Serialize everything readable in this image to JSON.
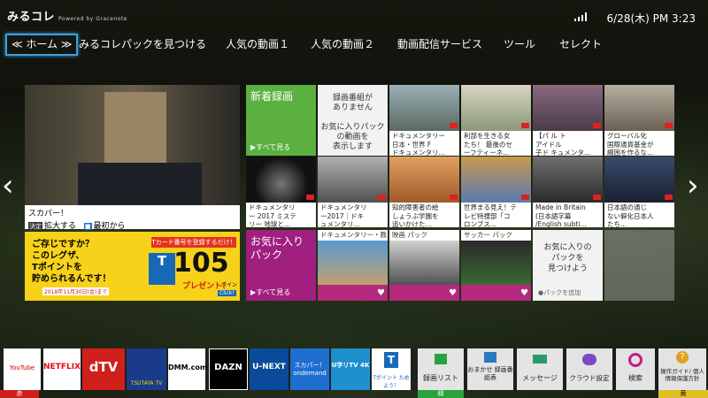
{
  "header": {
    "logo": "みるコレ",
    "logo_sub": "Powered by Gracenote",
    "clock": "6/28(木) PM 3:23"
  },
  "nav": {
    "items": [
      "≪ ホーム ≫",
      "みるコレパックを見つける",
      "人気の動画１",
      "人気の動画２",
      "動画配信サービス",
      "ツール",
      "セレクト"
    ]
  },
  "hero": {
    "caption": "スカパー！",
    "btn1": "決定",
    "btn1_label": "拡大する",
    "btn2": "■",
    "btn2_label": "最初から"
  },
  "promo": {
    "line1": "ご存じですか？",
    "line2": "このレグザ、",
    "line3": "Tポイントを",
    "line4": "貯められるんです！",
    "tag": "Tカード番号を登録するだけ！",
    "number": "105",
    "points": "ポイント",
    "present": "プレゼント！",
    "date": "2018年11月30日(金)まで",
    "tcard": "T",
    "click": "Click!"
  },
  "tiles": {
    "new_rec": {
      "title": "新着録画",
      "more": "▶すべて見る"
    },
    "no_rec": {
      "text": "録画番組が\nありません\n\nお気に入りパック\nの動画を\n表示します"
    },
    "row1": [
      {
        "cap": "ドキュメンタリー\n日本・世界 F\nドキュメンタリ..."
      },
      {
        "cap": "利部を生きる女\nたち！ 最後のセ\nーフティーネ..."
      },
      {
        "cap": "【パ ル ト\nアイドル\n子ド キュメンタ..."
      },
      {
        "cap": "グローバル化\n国際通貨基金が\n綱困を作るな..."
      }
    ],
    "row2": [
      {
        "cap": "ドキュメンタリ\nー 2017 ミステ\nリー 地球と..."
      },
      {
        "cap": "ドキュメンタリ\nー2017｜ドキ\nュメンタリ..."
      },
      {
        "cap": "知的障害者の絵\nしょうぶ学園を\n追いかけた..."
      },
      {
        "cap": "世界まる見え！テ\nレビ特捜部「コ\nロンブス..."
      },
      {
        "cap": "Made in Britain\n(日本語字幕\n/English subti..."
      },
      {
        "cap": "日本語の通じ\nない僻化日本人\nたち..."
      }
    ],
    "fav_pack": {
      "title": "お気に入り\nパック",
      "more": "▶すべて見る"
    },
    "packs": [
      {
        "title": "ドキュメンタリー・教養 パック"
      },
      {
        "title": "映画 パック"
      },
      {
        "title": "サッカー パック"
      }
    ],
    "find_pack": {
      "text": "お気に入りの\nパックを\n見つけよう",
      "add": "●パックを追加"
    }
  },
  "dock": {
    "apps": [
      "YouTube",
      "NETFLIX",
      "dTV",
      "TSUTAYA TV",
      "DMM.com",
      "DAZN",
      "U-NEXT",
      "スカパー！ondemand",
      "U字リTV 4K",
      "Tポイント ためよう！",
      "録画リスト",
      "おまかせ 録画番組表",
      "メッセージ",
      "クラウド設定",
      "検索",
      "操作ガイド/ 個人情報保護方針"
    ],
    "color_red": "赤",
    "color_green": "緑",
    "color_yellow": "黄"
  },
  "colors": {
    "accent_green": "#5cb040",
    "accent_magenta": "#a11f7f",
    "nav_sel": "#3aa0e0",
    "dock_red": "#d0201c",
    "dock_green": "#29a33c",
    "dock_yellow": "#e0c020"
  }
}
